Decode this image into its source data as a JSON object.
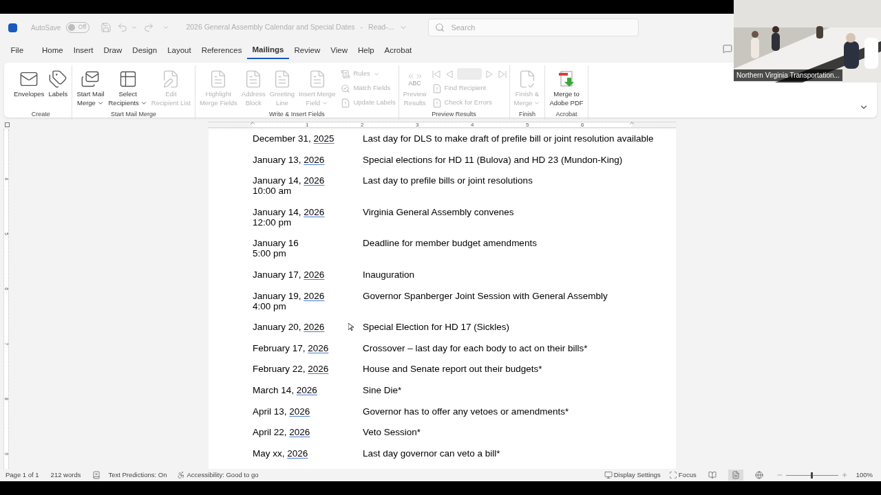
{
  "title_bar": {
    "autosave_label": "AutoSave",
    "autosave": {
      "on": false,
      "label": "Off"
    },
    "document_title": "2026 General Assembly Calendar and Special Dates",
    "title_separator": "-",
    "title_suffix": "Read-...",
    "search": {
      "placeholder": "Search"
    }
  },
  "tabs": [
    {
      "label": "File",
      "selected": false
    },
    {
      "label": "Home",
      "selected": false
    },
    {
      "label": "Insert",
      "selected": false
    },
    {
      "label": "Draw",
      "selected": false
    },
    {
      "label": "Design",
      "selected": false
    },
    {
      "label": "Layout",
      "selected": false
    },
    {
      "label": "References",
      "selected": false
    },
    {
      "label": "Mailings",
      "selected": true
    },
    {
      "label": "Review",
      "selected": false
    },
    {
      "label": "View",
      "selected": false
    },
    {
      "label": "Help",
      "selected": false
    },
    {
      "label": "Acrobat",
      "selected": false
    }
  ],
  "ribbon": {
    "groups": [
      {
        "label": "Create",
        "items": [
          {
            "kind": "large",
            "lines": [
              "Envelopes"
            ],
            "disabled": false,
            "dropdown": false
          },
          {
            "kind": "large",
            "lines": [
              "Labels"
            ],
            "disabled": false,
            "dropdown": false
          }
        ]
      },
      {
        "label": "Start Mail Merge",
        "items": [
          {
            "kind": "large",
            "lines": [
              "Start Mail",
              "Merge"
            ],
            "disabled": false,
            "dropdown": true
          },
          {
            "kind": "large",
            "lines": [
              "Select",
              "Recipients"
            ],
            "disabled": false,
            "dropdown": true
          },
          {
            "kind": "large",
            "lines": [
              "Edit",
              "Recipient List"
            ],
            "disabled": true,
            "dropdown": false
          }
        ]
      },
      {
        "label": "Write & Insert Fields",
        "items": [
          {
            "kind": "large",
            "lines": [
              "Highlight",
              "Merge Fields"
            ],
            "disabled": true,
            "dropdown": false
          },
          {
            "kind": "large",
            "lines": [
              "Address",
              "Block"
            ],
            "disabled": true,
            "dropdown": false
          },
          {
            "kind": "large",
            "lines": [
              "Greeting",
              "Line"
            ],
            "disabled": true,
            "dropdown": false
          },
          {
            "kind": "large",
            "lines": [
              "Insert Merge",
              "Field"
            ],
            "disabled": true,
            "dropdown": true
          },
          {
            "kind": "small",
            "lines": [
              "Rules"
            ],
            "disabled": true,
            "dropdown": true
          },
          {
            "kind": "small",
            "lines": [
              "Match Fields"
            ],
            "disabled": true,
            "dropdown": false
          },
          {
            "kind": "small",
            "lines": [
              "Update Labels"
            ],
            "disabled": true,
            "dropdown": false
          }
        ]
      },
      {
        "label": "Preview Results",
        "items": [
          {
            "kind": "large",
            "icon_text": "ABC",
            "lines": [
              "Preview",
              "Results"
            ],
            "disabled": true,
            "dropdown": false
          },
          {
            "kind": "nav",
            "disabled": true
          },
          {
            "kind": "small",
            "lines": [
              "Find Recipient"
            ],
            "disabled": true,
            "dropdown": false
          },
          {
            "kind": "small",
            "lines": [
              "Check for Errors"
            ],
            "disabled": true,
            "dropdown": false
          }
        ]
      },
      {
        "label": "Finish",
        "items": [
          {
            "kind": "large",
            "lines": [
              "Finish &",
              "Merge"
            ],
            "disabled": true,
            "dropdown": true
          }
        ]
      },
      {
        "label": "Acrobat",
        "items": [
          {
            "kind": "large",
            "lines": [
              "Merge to",
              "Adobe PDF"
            ],
            "disabled": false,
            "dropdown": false
          }
        ]
      }
    ]
  },
  "ruler": {
    "h_numbers": [
      "1",
      "2",
      "3",
      "4",
      "5",
      "6"
    ],
    "v_numbers": [
      "4",
      "5",
      "6",
      "7",
      "8",
      "9"
    ]
  },
  "document": {
    "entries": [
      {
        "date": "December 31,",
        "year": "2025",
        "event": "Last day for DLS to make draft of prefile bill or joint resolution available"
      },
      {
        "date": "January 13,",
        "year": "2026",
        "event": "Special elections for HD 11 (Bulova) and HD 23 (Mundon-King)"
      },
      {
        "date": "January 14,",
        "year": "2026",
        "time": "10:00 am",
        "event": "Last day to prefile bills or joint resolutions"
      },
      {
        "date": "January 14,",
        "year": "2026",
        "time": "12:00 pm",
        "event": "Virginia General Assembly convenes"
      },
      {
        "date": "January 16",
        "time": "5:00 pm",
        "event": "Deadline for member budget amendments"
      },
      {
        "date": "January 17,",
        "year": "2026",
        "event": "Inauguration"
      },
      {
        "date": "January 19,",
        "year": "2026",
        "time": "4:00 pm",
        "event": "Governor Spanberger Joint Session with General Assembly"
      },
      {
        "date": "January 20,",
        "year": "2026",
        "event": "Special Election for HD 17 (Sickles)"
      },
      {
        "date": "February 17,",
        "year": "2026",
        "event": "Crossover – last day for each body to act on their bills*"
      },
      {
        "date": "February 22,",
        "year": "2026",
        "event": "House and Senate report out their budgets*"
      },
      {
        "date": "March 14,",
        "year": "2026",
        "event": "Sine Die*"
      },
      {
        "date": "April 13,",
        "year": "2026",
        "event": "Governor has to offer any vetoes or amendments*"
      },
      {
        "date": "April 22,",
        "year": "2026",
        "event": "Veto Session*"
      },
      {
        "date": "May xx,",
        "year": "2026",
        "event": "Last day governor can veto a bill*"
      }
    ]
  },
  "status_bar": {
    "page": "Page 1 of 1",
    "words": "212 words",
    "text_predictions": "Text Predictions: On",
    "accessibility": "Accessibility: Good to go",
    "display_settings": "Display Settings",
    "focus": "Focus",
    "views": [
      {
        "kind": "read",
        "selected": false
      },
      {
        "kind": "print",
        "selected": true
      },
      {
        "kind": "web",
        "selected": false
      }
    ],
    "zoom": {
      "level": 0.5,
      "label": "100%"
    }
  },
  "video": {
    "kind": "picture",
    "name": "Northern Virginia Transportation..."
  }
}
